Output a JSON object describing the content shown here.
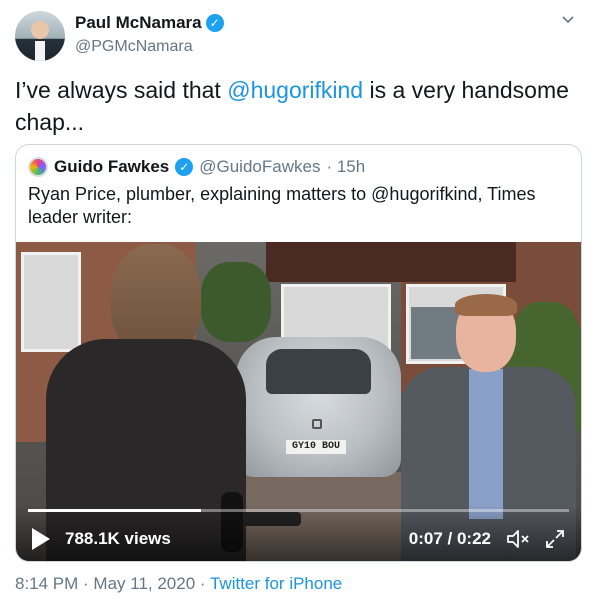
{
  "tweet": {
    "author_name": "Paul McNamara",
    "author_handle": "@PGMcNamara",
    "text_before": "I’ve always said that ",
    "text_mention": "@hugorifkind",
    "text_after": " is a very handsome chap...",
    "timestamp": "8:14 PM · May 11, 2020 · ",
    "source": "Twitter for iPhone"
  },
  "quoted": {
    "author_name": "Guido Fawkes",
    "author_handle": "@GuidoFawkes",
    "age": " · 15h",
    "text": "Ryan Price, plumber, explaining matters to @hugorifkind, Times leader writer:",
    "video": {
      "plate_text": "GY10 BOU",
      "views": "788.1K views",
      "time": "0:07 / 0:22",
      "progress_fraction": 0.32
    }
  },
  "icons": {
    "verified": "verified-badge-icon",
    "caret": "chevron-down-icon",
    "play": "play-icon",
    "mute": "volume-muted-icon",
    "expand": "expand-icon"
  },
  "colors": {
    "link": "#1b95e0",
    "verified": "#1da1f2",
    "secondary_text": "#657786"
  }
}
